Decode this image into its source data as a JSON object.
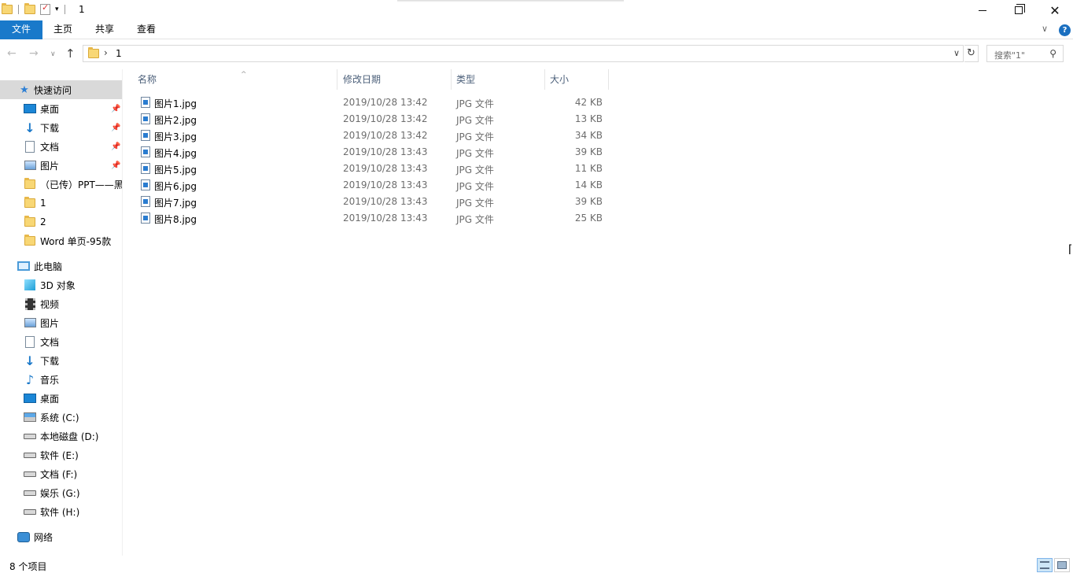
{
  "window": {
    "title": "1"
  },
  "ribbon": {
    "file": "文件",
    "home": "主页",
    "share": "共享",
    "view": "查看",
    "help": "?"
  },
  "address": {
    "path": "1"
  },
  "search": {
    "placeholder": "搜索\"1\""
  },
  "nav": {
    "quick_access": "快速访问",
    "quick_items": [
      {
        "label": "桌面",
        "icon": "desktop-icon"
      },
      {
        "label": "下载",
        "icon": "download-icon"
      },
      {
        "label": "文档",
        "icon": "document-icon"
      },
      {
        "label": "图片",
        "icon": "picture-icon"
      },
      {
        "label": "（已传）PPT——黑",
        "icon": "folder-icon"
      },
      {
        "label": "1",
        "icon": "folder-icon"
      },
      {
        "label": "2",
        "icon": "folder-icon"
      },
      {
        "label": "Word 单页-95款",
        "icon": "folder-icon"
      }
    ],
    "this_pc": "此电脑",
    "pc_items": [
      {
        "label": "3D 对象",
        "icon": "3d-objects-icon"
      },
      {
        "label": "视频",
        "icon": "video-icon"
      },
      {
        "label": "图片",
        "icon": "picture-icon"
      },
      {
        "label": "文档",
        "icon": "document-icon"
      },
      {
        "label": "下载",
        "icon": "download-icon"
      },
      {
        "label": "音乐",
        "icon": "music-icon"
      },
      {
        "label": "桌面",
        "icon": "desktop-icon"
      },
      {
        "label": "系统 (C:)",
        "icon": "system-drive-icon"
      },
      {
        "label": "本地磁盘 (D:)",
        "icon": "drive-icon"
      },
      {
        "label": "软件 (E:)",
        "icon": "drive-icon"
      },
      {
        "label": "文档 (F:)",
        "icon": "drive-icon"
      },
      {
        "label": "娱乐 (G:)",
        "icon": "drive-icon"
      },
      {
        "label": "软件 (H:)",
        "icon": "drive-icon"
      }
    ],
    "network": "网络"
  },
  "columns": {
    "name": "名称",
    "date": "修改日期",
    "type": "类型",
    "size": "大小"
  },
  "files": [
    {
      "name": "图片1.jpg",
      "date": "2019/10/28 13:42",
      "type": "JPG 文件",
      "size": "42 KB"
    },
    {
      "name": "图片2.jpg",
      "date": "2019/10/28 13:42",
      "type": "JPG 文件",
      "size": "13 KB"
    },
    {
      "name": "图片3.jpg",
      "date": "2019/10/28 13:42",
      "type": "JPG 文件",
      "size": "34 KB"
    },
    {
      "name": "图片4.jpg",
      "date": "2019/10/28 13:43",
      "type": "JPG 文件",
      "size": "39 KB"
    },
    {
      "name": "图片5.jpg",
      "date": "2019/10/28 13:43",
      "type": "JPG 文件",
      "size": "11 KB"
    },
    {
      "name": "图片6.jpg",
      "date": "2019/10/28 13:43",
      "type": "JPG 文件",
      "size": "14 KB"
    },
    {
      "name": "图片7.jpg",
      "date": "2019/10/28 13:43",
      "type": "JPG 文件",
      "size": "39 KB"
    },
    {
      "name": "图片8.jpg",
      "date": "2019/10/28 13:43",
      "type": "JPG 文件",
      "size": "25 KB"
    }
  ],
  "status": {
    "count": "8 个项目"
  },
  "colors": {
    "accent": "#1979ca",
    "selection": "#d9d9d9",
    "header_text": "#4c607a"
  }
}
